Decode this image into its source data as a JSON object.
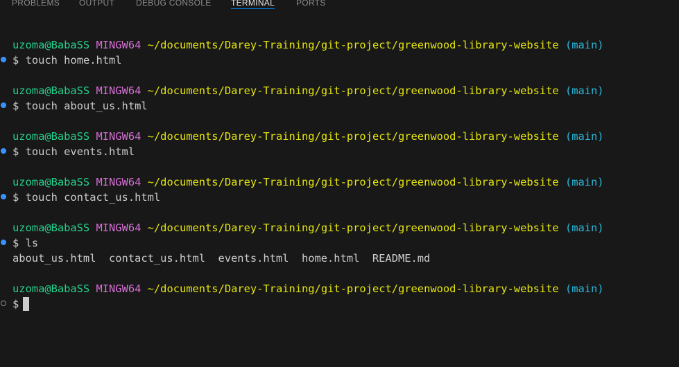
{
  "panel": {
    "tabs": [
      {
        "label": "PROBLEMS"
      },
      {
        "label": "OUTPUT"
      },
      {
        "label": "DEBUG CONSOLE"
      },
      {
        "label": "TERMINAL"
      },
      {
        "label": "PORTS"
      }
    ],
    "active_tab": "TERMINAL"
  },
  "prompt": {
    "user_host": "uzoma@BabaSS",
    "shell": "MINGW64",
    "path": "~/documents/Darey-Training/git-project/greenwood-library-website",
    "branch": "(main)",
    "symbol": "$"
  },
  "history": [
    {
      "command": "touch home.html",
      "status": "success"
    },
    {
      "command": "touch about_us.html",
      "status": "success"
    },
    {
      "command": "touch events.html",
      "status": "success"
    },
    {
      "command": "touch contact_us.html",
      "status": "success"
    },
    {
      "command": "ls",
      "status": "success",
      "output": "about_us.html  contact_us.html  events.html  home.html  README.md"
    }
  ],
  "current": {
    "command": "",
    "status": "pending"
  },
  "colors": {
    "background": "#181818",
    "user_host": "#23d18b",
    "shell": "#c586c0",
    "path": "#e5e510",
    "branch": "#29b8db",
    "text": "#cccccc",
    "decoration_success": "#3794ff",
    "active_tab_underline": "#0078d4"
  }
}
